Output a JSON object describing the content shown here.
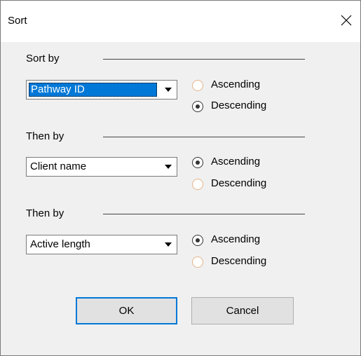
{
  "window": {
    "title": "Sort",
    "close_glyph": "X"
  },
  "groups": [
    {
      "label": "Sort by",
      "field": "Pathway ID",
      "options": [
        {
          "label": "Ascending",
          "checked": false
        },
        {
          "label": "Descending",
          "checked": true
        }
      ]
    },
    {
      "label": "Then by",
      "field": "Client name",
      "options": [
        {
          "label": "Ascending",
          "checked": true
        },
        {
          "label": "Descending",
          "checked": false
        }
      ]
    },
    {
      "label": "Then by",
      "field": "Active length",
      "options": [
        {
          "label": "Ascending",
          "checked": true
        },
        {
          "label": "Descending",
          "checked": false
        }
      ]
    }
  ],
  "buttons": {
    "ok_label": "OK",
    "cancel_label": "Cancel"
  },
  "colors": {
    "selection": "#0078d7",
    "dialog_bg": "#f0f0f0",
    "button_bg": "#e1e1e1"
  }
}
